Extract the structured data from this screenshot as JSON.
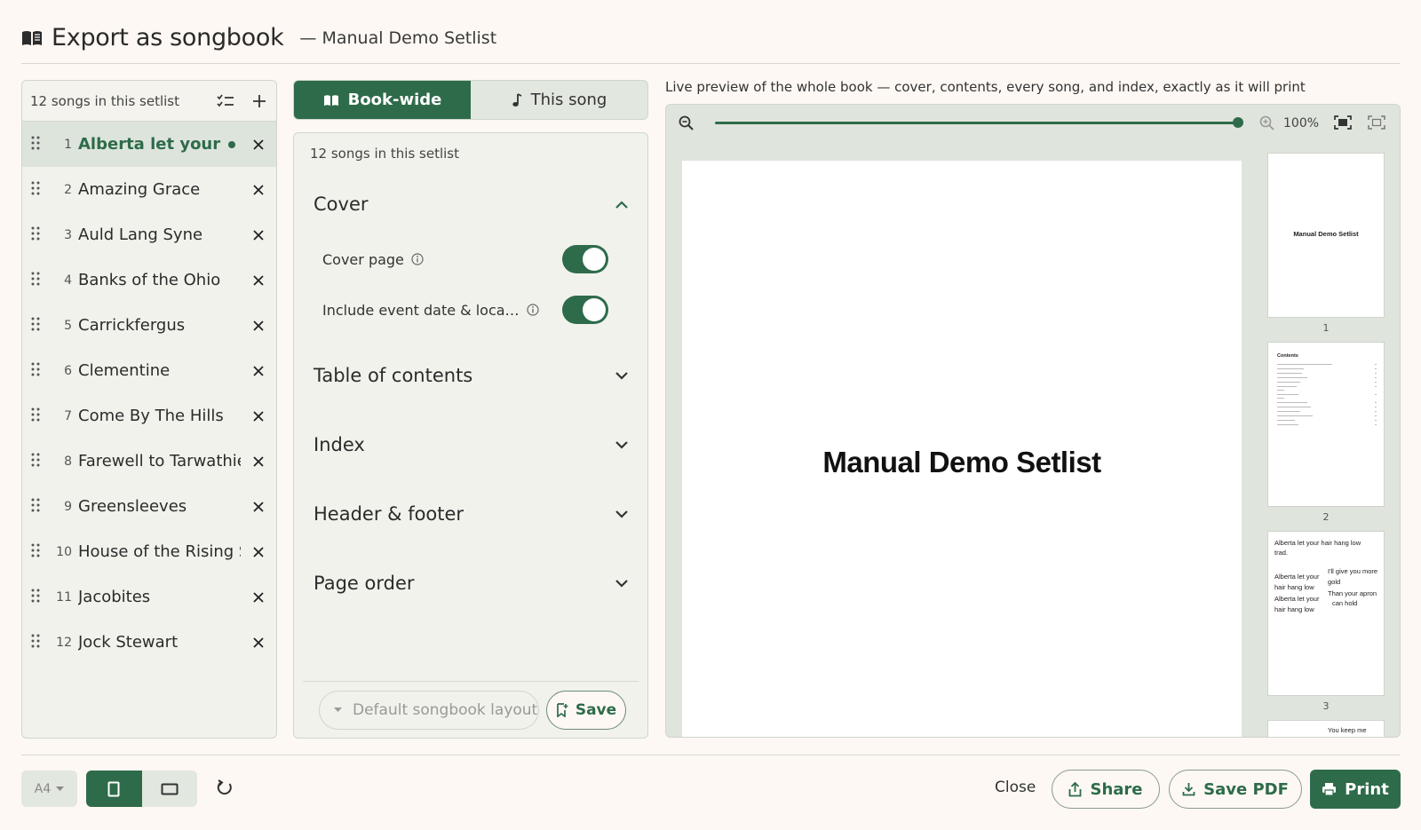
{
  "header": {
    "title": "Export as songbook",
    "subtitle": "— Manual Demo Setlist"
  },
  "setlist": {
    "count_label": "12 songs in this setlist",
    "songs": [
      {
        "num": "1",
        "title": "Alberta let your ha…",
        "active": true
      },
      {
        "num": "2",
        "title": "Amazing Grace"
      },
      {
        "num": "3",
        "title": "Auld Lang Syne"
      },
      {
        "num": "4",
        "title": "Banks of the Ohio"
      },
      {
        "num": "5",
        "title": "Carrickfergus"
      },
      {
        "num": "6",
        "title": "Clementine"
      },
      {
        "num": "7",
        "title": "Come By The Hills"
      },
      {
        "num": "8",
        "title": "Farewell to Tarwathie"
      },
      {
        "num": "9",
        "title": "Greensleeves"
      },
      {
        "num": "10",
        "title": "House of the Rising S…"
      },
      {
        "num": "11",
        "title": "Jacobites"
      },
      {
        "num": "12",
        "title": "Jock Stewart"
      }
    ]
  },
  "tabs": {
    "book_wide": "Book-wide",
    "this_song": "This song"
  },
  "settings": {
    "count_label": "12 songs in this setlist",
    "cover": {
      "label": "Cover",
      "cover_page": "Cover page",
      "include_event": "Include event date & loca…"
    },
    "sections": [
      "Table of contents",
      "Index",
      "Header & footer",
      "Page order"
    ],
    "layout_select": "Default songbook layout",
    "save": "Save"
  },
  "preview": {
    "caption": "Live preview of the whole book — cover, contents, every song, and index, exactly as it will print",
    "zoom_level": "100%",
    "page_title": "Manual Demo Setlist",
    "thumbs": [
      {
        "num": "1",
        "title": "Manual Demo Setlist"
      },
      {
        "num": "2",
        "title": "Contents"
      },
      {
        "num": "3",
        "song_title": "Alberta let your hair hang low",
        "song_artist": "trad.",
        "left_lines": [
          "Alberta let your",
          "hair hang low",
          "Alberta let your",
          "hair hang low"
        ],
        "right_lines": [
          "I'll give you more",
          "gold",
          "Than your apron",
          "can hold"
        ]
      },
      {
        "num": "4",
        "partial_text": "You keep me"
      }
    ]
  },
  "bottom": {
    "paper_size": "A4",
    "close": "Close",
    "share": "Share",
    "save_pdf": "Save PDF",
    "print": "Print"
  },
  "colors": {
    "accent": "#2e6b4a",
    "background": "#fdf8f3",
    "panel": "#f1f2ec"
  }
}
